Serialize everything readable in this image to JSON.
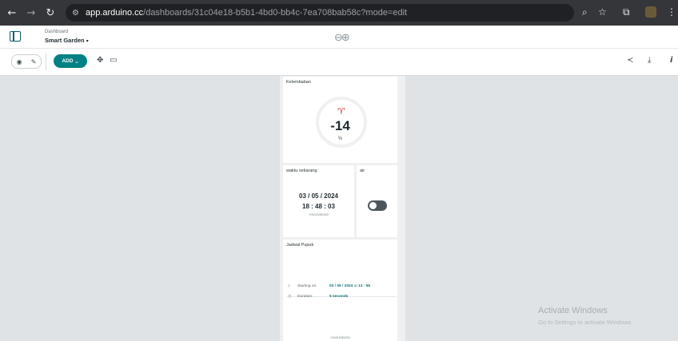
{
  "browser": {
    "url_host": "app.arduino.cc",
    "url_path": "/dashboards/31c04e18-b5b1-4bd0-bb4c-7ea708bab58c?mode=edit"
  },
  "header": {
    "breadcrumb_label": "Dashboard",
    "dashboard_name": "Smart Garden",
    "dropdown_caret": "▾"
  },
  "toolbar": {
    "add_label": "ADD",
    "add_caret": "⌄"
  },
  "widgets": {
    "gauge": {
      "title": "Kelembaban",
      "value": "-14",
      "unit": "%"
    },
    "clock": {
      "title": "waktu sekarang",
      "date": "03 / 05 / 2024",
      "time": "18 : 48 : 03",
      "timezone": "Asia/Jakarta"
    },
    "switch": {
      "title": "air",
      "state": "off"
    },
    "schedule": {
      "title": "Jadwal Pupuk",
      "start_label": "Starting on:",
      "start_date": "03 / 05 / 2024",
      "start_at": "at",
      "start_time": "13 : 56",
      "duration_label": "Duration:",
      "duration_value": "5 seconds",
      "timezone": "Asia/Jakarta"
    }
  },
  "watermark": {
    "title": "Activate Windows",
    "subtitle": "Go to Settings to activate Windows."
  },
  "colors": {
    "accent": "#008184",
    "gauge_icon": "#d4343a",
    "chrome": "#35363a"
  },
  "icons": [
    "back-icon",
    "forward-icon",
    "reload-icon",
    "site-settings-icon",
    "zoom-icon",
    "bookmark-star-icon",
    "extensions-icon",
    "menu-kebab-icon",
    "sidebar-toggle-icon",
    "arduino-logo-icon",
    "eye-icon",
    "edit-icon",
    "move-icon",
    "monitor-icon",
    "share-icon",
    "download-icon",
    "info-icon",
    "plant-icon",
    "play-icon",
    "clock-icon"
  ]
}
